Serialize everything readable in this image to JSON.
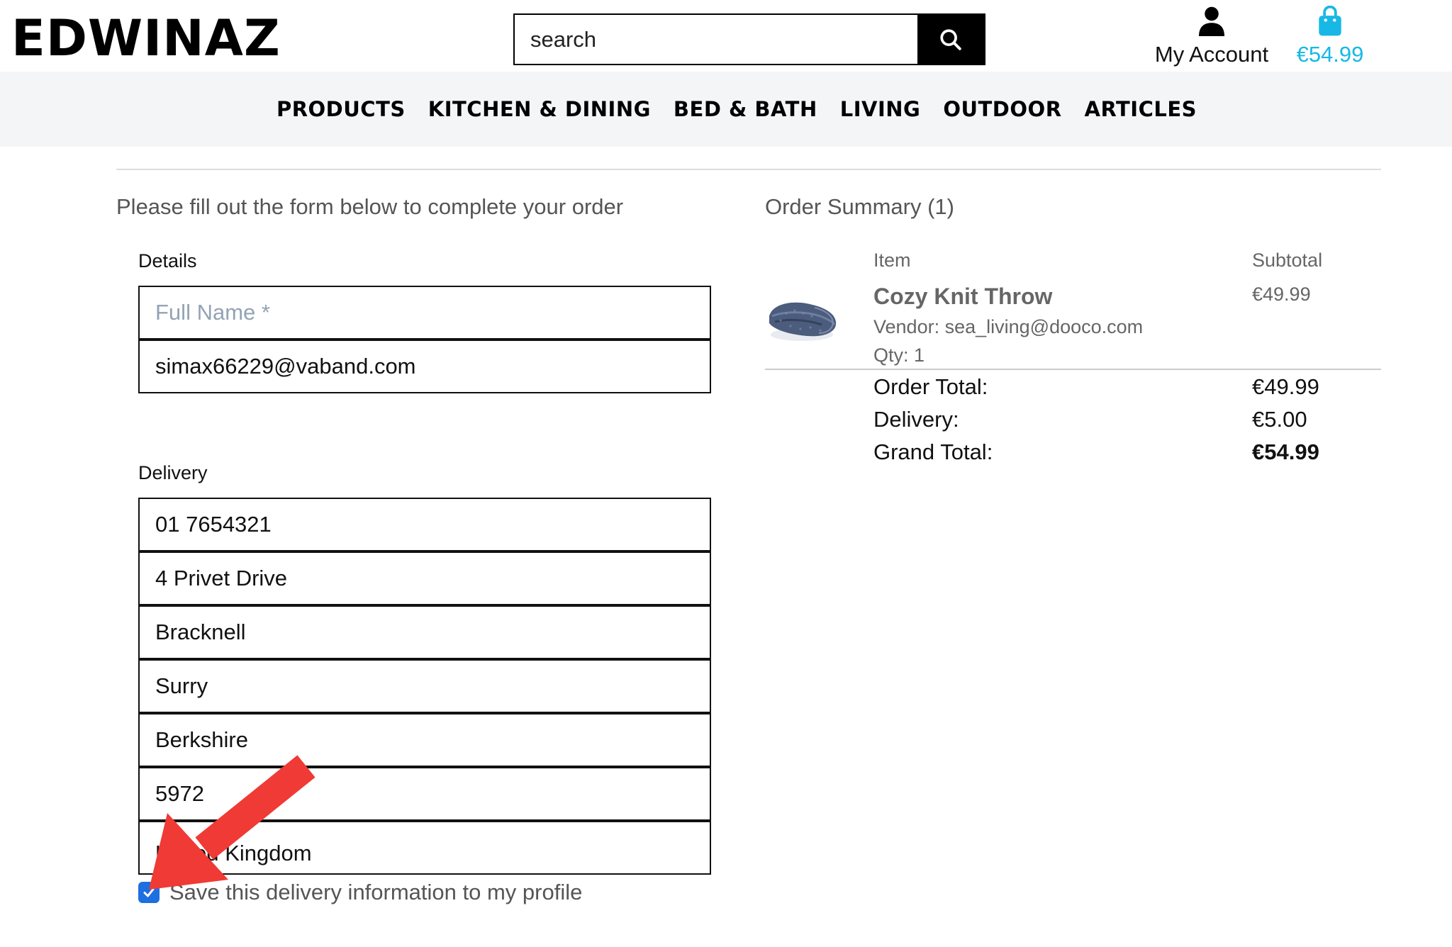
{
  "header": {
    "logo": "EDWINAZ",
    "search": {
      "placeholder": "search"
    },
    "account_label": "My Account",
    "bag_total": "€54.99",
    "accent_color": "#17b8e6"
  },
  "nav": {
    "items": [
      "PRODUCTS",
      "KITCHEN & DINING",
      "BED & BATH",
      "LIVING",
      "OUTDOOR",
      "ARTICLES"
    ]
  },
  "form": {
    "intro": "Please fill out the form below to complete your order",
    "details_label": "Details",
    "full_name_placeholder": "Full Name *",
    "email_value": "simax66229@vaband.com",
    "delivery_label": "Delivery",
    "phone_value": "01 7654321",
    "street_value": "4 Privet Drive",
    "town_value": "Bracknell",
    "county_value": "Surry",
    "region_value": "Berkshire",
    "postcode_value": "5972",
    "country_value": "United Kingdom",
    "save_label": "Save this delivery information to my profile",
    "save_checked": true
  },
  "summary": {
    "title": "Order Summary (1)",
    "item_header": "Item",
    "subtotal_header": "Subtotal",
    "product": {
      "name": "Cozy Knit Throw",
      "vendor": "Vendor: sea_living@dooco.com",
      "qty": "Qty: 1",
      "price": "€49.99"
    },
    "order_total_label": "Order Total:",
    "order_total_value": "€49.99",
    "delivery_label": "Delivery:",
    "delivery_value": "€5.00",
    "grand_total_label": "Grand Total:",
    "grand_total_value": "€54.99"
  },
  "annotation": {
    "arrow_color": "#f03a35"
  }
}
